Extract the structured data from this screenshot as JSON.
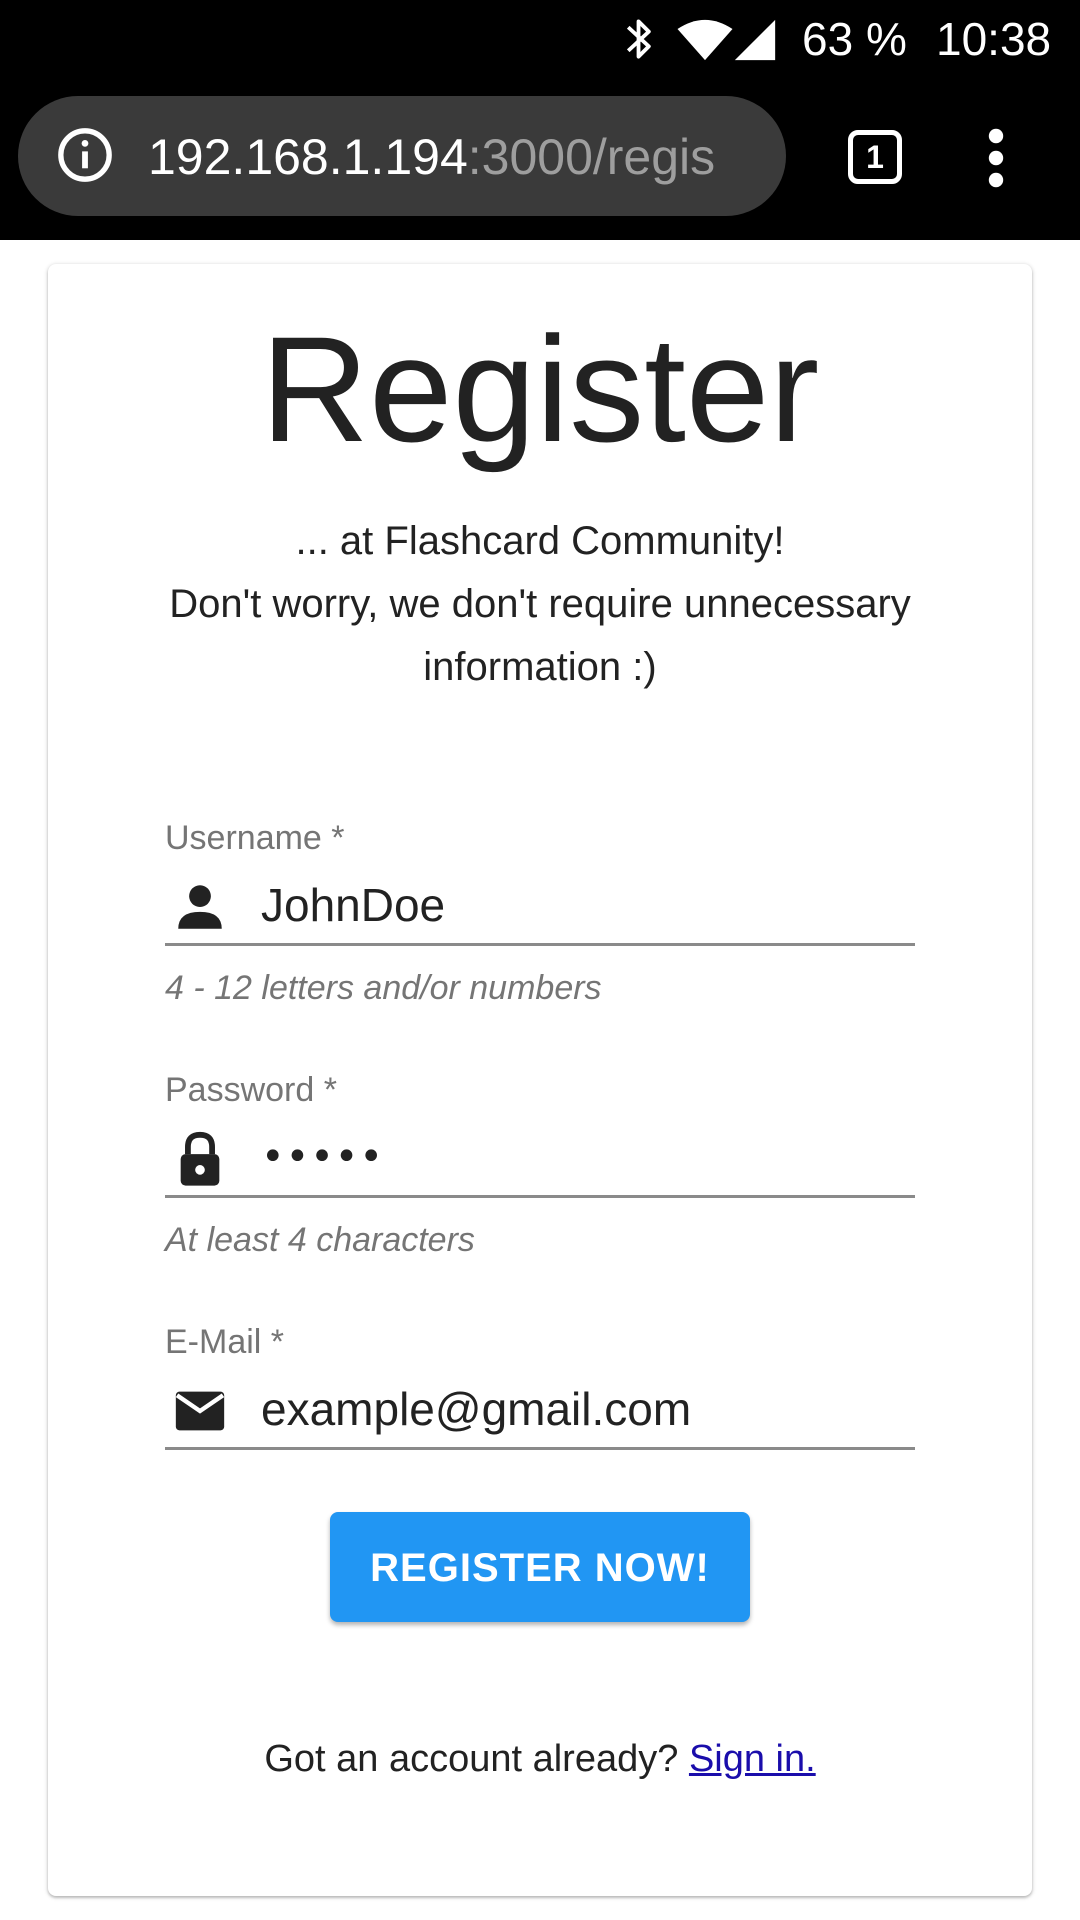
{
  "status_bar": {
    "battery": "63 %",
    "time": "10:38",
    "icons": [
      "bluetooth-icon",
      "wifi-icon",
      "cell-signal-icon"
    ]
  },
  "browser": {
    "url_host": "192.168.1.194",
    "url_path": ":3000/regis",
    "tab_count": "1",
    "icons": [
      "info-icon",
      "tabs-icon",
      "overflow-menu-icon"
    ]
  },
  "page": {
    "title": "Register",
    "subtitle_line1": "... at Flashcard Community!",
    "subtitle_line2": "Don't worry, we don't require unnecessary information :)"
  },
  "form": {
    "username": {
      "label": "Username *",
      "value": "JohnDoe",
      "helper": "4 - 12 letters and/or numbers",
      "icon": "person-icon"
    },
    "password": {
      "label": "Password *",
      "value": "•••••",
      "helper": "At least 4 characters",
      "icon": "lock-icon"
    },
    "email": {
      "label": "E-Mail *",
      "value": "example@gmail.com",
      "icon": "email-icon"
    },
    "submit_label": "REGISTER NOW!"
  },
  "footer": {
    "prompt": "Got an account already?",
    "link_text": "Sign in."
  },
  "colors": {
    "primary_button": "#2196f3",
    "link": "#1a0dab",
    "label_gray": "#757575",
    "toolbar_bg": "#000000",
    "url_bar_bg": "#3a3a3a"
  }
}
